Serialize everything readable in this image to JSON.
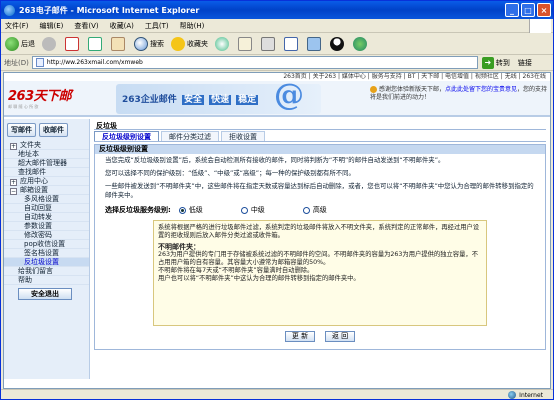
{
  "window": {
    "title": "263电子邮件 - Microsoft Internet Explorer",
    "min": "_",
    "max": "□",
    "close": "×"
  },
  "menubar": {
    "items": [
      "文件(F)",
      "编辑(E)",
      "查看(V)",
      "收藏(A)",
      "工具(T)",
      "帮助(H)"
    ]
  },
  "toolbar": {
    "back": "后退",
    "search": "搜索",
    "favorites": "收藏夹"
  },
  "addressbar": {
    "label": "地址(D)",
    "url": "http://ww.263xmail.com/xmweb",
    "go": "转到",
    "links": "链接"
  },
  "site": {
    "toplinks": "263首页 | 关于263 | 媒体中心 | 服务与支持 | BT | 天下邮 | 电信增值 | 视频社区 | 无线 | 263在线",
    "logo": "263天下邮",
    "logo_sub": "邮 聊 随 心 所 欲",
    "slogan": "263企业邮件",
    "slogan_words": [
      "安全",
      "快速",
      "稳定"
    ],
    "notice_prefix": "感谢您体验新版天下邮，",
    "notice_link": "点此此处留下您的宝贵意见",
    "notice_suffix": "，您的支持将是我们前进的动力！",
    "at_symbol": "@"
  },
  "sidebar": {
    "write": "写邮件",
    "receive": "收邮件",
    "items": [
      {
        "label": "文件夹",
        "type": "plus"
      },
      {
        "label": "地址本",
        "type": "nm"
      },
      {
        "label": "超大邮件管理器",
        "type": "nm"
      },
      {
        "label": "查找邮件",
        "type": "nm"
      },
      {
        "label": "应用中心",
        "type": "plus"
      },
      {
        "label": "邮箱设置",
        "type": "minus"
      },
      {
        "label": "多风格设置",
        "type": "sub"
      },
      {
        "label": "自动回复",
        "type": "sub"
      },
      {
        "label": "自动转发",
        "type": "sub"
      },
      {
        "label": "参数设置",
        "type": "sub"
      },
      {
        "label": "修改密码",
        "type": "sub"
      },
      {
        "label": "pop收信设置",
        "type": "sub"
      },
      {
        "label": "签名档设置",
        "type": "sub"
      },
      {
        "label": "反垃圾设置",
        "type": "sub",
        "active": true
      },
      {
        "label": "给我们留言",
        "type": "nm"
      },
      {
        "label": "帮助",
        "type": "nm"
      }
    ],
    "logout": "安全退出"
  },
  "main": {
    "title": "反垃圾",
    "tabs": [
      "反垃圾级别设置",
      "邮件分类过滤",
      "拒收设置"
    ],
    "panel_title": "反垃圾级别设置",
    "p1": "当您完成“反垃圾级别设置”后，系统会自动检测所有接收的邮件，同时将判断为“不明”的邮件自动发送到“不明邮件夹”。",
    "p2": "您可以选择不同的保护级别：“低级”、“中级”或“高级”；每一种的保护级别都有所不同。",
    "p3": "一些邮件被发送到“不明邮件夹”中，这些邮件将在指定天数或容量达到标后自动删除，或者，您也可以将“不明邮件夹”中您认为合理的邮件转移到指定的邮件夹中。",
    "radio_label": "选择反垃圾服务级别:",
    "levels": [
      "低级",
      "中级",
      "高级"
    ],
    "selected_level": "低级",
    "info1": "系统将根据严格的进行垃圾邮件过滤，系统判定的垃圾邮件将放入不明文件夹，系统判定的正常邮件，再经过用户设置的拒收规则后放入邮件分类过滤或收件箱。",
    "info_head": "不明邮件夹：",
    "info2": "263为用户提供的专门用于存储被系统过滤的不明邮件的空间。不明邮件夹的容量为263为用户提供的独立容量，不占用用户箱的自有容量。其容量大小遵常为邮箱容量的50%。",
    "info3": "不明邮件将在每7天或“不明邮件夹”容量满时自动删除。",
    "info4": "用户也可以将“不明邮件夹”中这认为合理的邮件转移到指定的邮件夹中。",
    "save": "更 新",
    "back": "返 回"
  },
  "status": {
    "zone": "Internet"
  }
}
